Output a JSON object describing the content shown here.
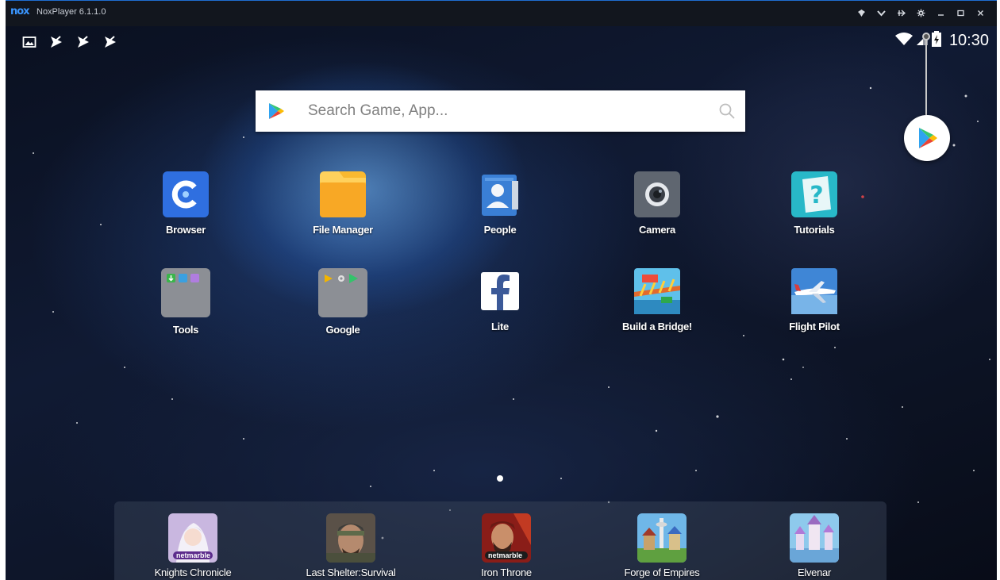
{
  "window": {
    "app_name": "NoxPlayer 6.1.1.0",
    "logo": "nox",
    "controls": [
      "pin-icon",
      "dropdown-icon",
      "expand-icon",
      "settings-icon",
      "minimize-icon",
      "maximize-icon",
      "close-icon"
    ]
  },
  "statusbar": {
    "notifications": [
      "image-notification-icon",
      "app-notification-icon",
      "app-notification-icon",
      "app-notification-icon"
    ],
    "icons": [
      "wifi-icon",
      "signal-icon",
      "battery-charging-icon"
    ],
    "time": "10:30"
  },
  "search": {
    "placeholder": "Search Game, App..."
  },
  "apps": [
    {
      "label": "Browser",
      "icon": "browser-icon"
    },
    {
      "label": "File Manager",
      "icon": "folder-icon"
    },
    {
      "label": "People",
      "icon": "contacts-icon"
    },
    {
      "label": "Camera",
      "icon": "camera-icon"
    },
    {
      "label": "Tutorials",
      "icon": "tutorials-icon"
    },
    {
      "label": "Tools",
      "icon": "tools-folder-icon"
    },
    {
      "label": "Google",
      "icon": "google-folder-icon"
    },
    {
      "label": "Lite",
      "icon": "facebook-icon"
    },
    {
      "label": "Build a Bridge!",
      "icon": "bridge-game-icon"
    },
    {
      "label": "Flight Pilot",
      "icon": "airplane-icon"
    }
  ],
  "dock": [
    {
      "label": "Knights Chronicle",
      "badge": "netmarble"
    },
    {
      "label": "Last Shelter:Survival",
      "badge": ""
    },
    {
      "label": "Iron Throne",
      "badge": "netmarble"
    },
    {
      "label": "Forge of Empires",
      "badge": ""
    },
    {
      "label": "Elvenar",
      "badge": ""
    }
  ],
  "colors": {
    "accent": "#3a96ff",
    "titlebar": "#12161e",
    "browser": "#2f6fe0",
    "file_manager": "#f9b930",
    "tutorials": "#28b8c8",
    "facebook": "#3b5998"
  }
}
